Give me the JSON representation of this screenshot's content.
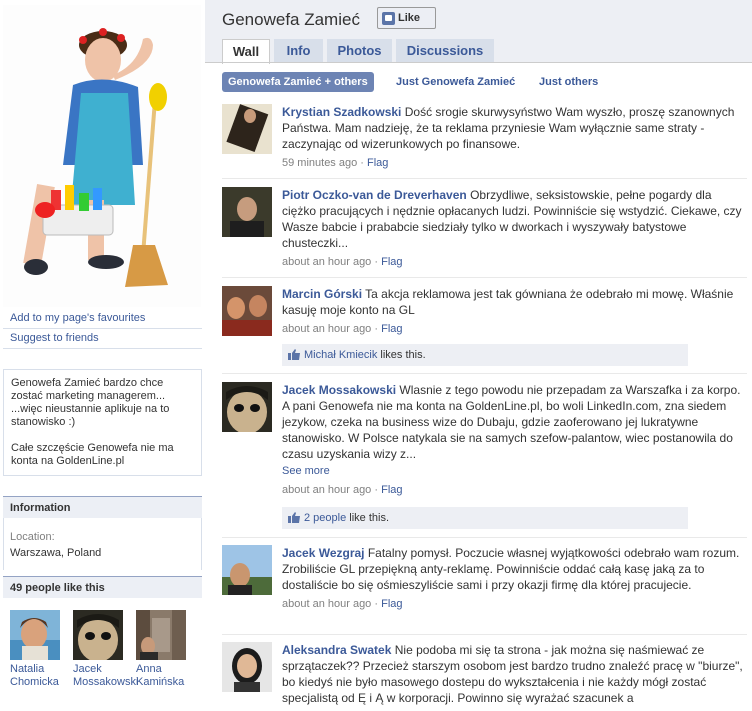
{
  "profile": {
    "name": "Genowefa Zamieć",
    "like_label": "Like",
    "add_favourites": "Add to my page's favourites",
    "suggest_friends": "Suggest to friends",
    "bio_lines": [
      "Genowefa Zamieć bardzo chce zostać marketing managerem... ...więc nieustannie aplikuje na to stanowisko :)",
      "Całe szczęście Genowefa nie ma konta na GoldenLine.pl"
    ]
  },
  "information": {
    "header": "Information",
    "location_label": "Location:",
    "location_value": "Warszawa, Poland"
  },
  "fans": {
    "header": "49 people like this",
    "people": [
      {
        "name": "Natalia Chomicka"
      },
      {
        "name": "Jacek Mossakowski"
      },
      {
        "name": "Anna Kamińska"
      }
    ]
  },
  "tabs": [
    {
      "label": "Wall",
      "active": true
    },
    {
      "label": "Info",
      "active": false
    },
    {
      "label": "Photos",
      "active": false
    },
    {
      "label": "Discussions",
      "active": false
    }
  ],
  "filters": [
    {
      "label": "Genowefa Zamieć + others",
      "active": true
    },
    {
      "label": "Just Genowefa Zamieć",
      "active": false
    },
    {
      "label": "Just others",
      "active": false
    }
  ],
  "posts": [
    {
      "author": "Krystian Szadkowski",
      "text": "Dość srogie skurwysyństwo Wam wyszło, proszę szanownych Państwa. Mam nadzieję, że ta reklama przyniesie Wam wyłącznie same straty - zaczynając od wizerunkowych po finansowe.",
      "time": "59 minutes ago",
      "flag": "Flag"
    },
    {
      "author": "Piotr Oczko-van de Dreverhaven",
      "text": "Obrzydliwe, seksistowskie, pełne pogardy dla ciężko pracujących i nędznie opłacanych ludzi. Powinniście się wstydzić. Ciekawe, czy Wasze babcie i prababcie siedziały tylko w dworkach i wyszywały batystowe chusteczki...",
      "time": "about an hour ago",
      "flag": "Flag"
    },
    {
      "author": "Marcin Górski",
      "text": "Ta akcja reklamowa jest tak gówniana że odebrało mi mowę. Właśnie kasuję moje konto na GL",
      "time": "about an hour ago",
      "flag": "Flag",
      "likes_name": "Michał Kmiecik",
      "likes_suffix": "likes this."
    },
    {
      "author": "Jacek Mossakowski",
      "text": "Wlasnie z tego powodu nie przepadam za Warszafka i za korpo. A pani Genowefa nie ma konta na GoldenLine.pl, bo woli LinkedIn.com, zna siedem jezykow, czeka na business wize do Dubaju, gdzie zaoferowano jej lukratywne stanowisko. W Polsce natykala sie na samych szefow-palantow, wiec postanowila do czasu uzyskania wizy z...",
      "see_more": "See more",
      "time": "about an hour ago",
      "flag": "Flag",
      "likes_name": "2 people",
      "likes_suffix": "like this."
    },
    {
      "author": "Jacek Wezgraj",
      "text": "Fatalny pomysł. Poczucie własnej wyjątkowości odebrało wam rozum. Zrobiliście GL przepiękną anty-reklamę. Powinniście oddać całą kasę jaką za to dostaliście bo się ośmieszyliście sami i przy okazji firmę dla której pracujecie.",
      "time": "about an hour ago",
      "flag": "Flag"
    },
    {
      "author": "Aleksandra Swatek",
      "text": "Nie podoba mi się ta strona - jak można się naśmiewać ze sprzątaczek?? Przecież starszym osobom jest bardzo trudno znaleźć pracę w \"biurze\", bo kiedyś nie było masowego dostepu do wykształcenia i nie każdy mógł zostać specjalistą od Ę i Ą w korporacji. Powinno się wyrażać szacunek a"
    }
  ]
}
